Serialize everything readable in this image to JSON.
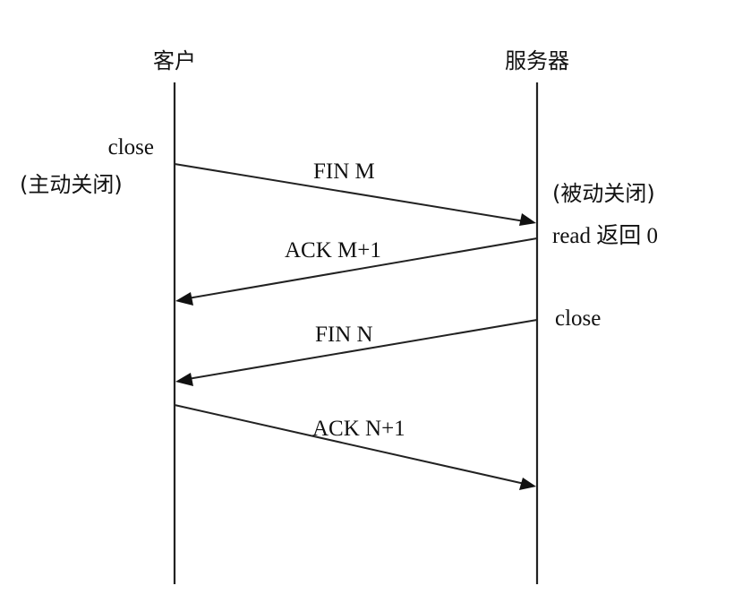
{
  "participants": {
    "client": "客户",
    "server": "服务器"
  },
  "client_notes": {
    "close": "close",
    "active_close": "(主动关闭)"
  },
  "server_notes": {
    "passive_close": "(被动关闭)",
    "read_returns": "read 返回 0",
    "close": "close"
  },
  "messages": [
    {
      "label": "FIN M",
      "direction": "client-to-server"
    },
    {
      "label": "ACK M+1",
      "direction": "server-to-client"
    },
    {
      "label": "FIN N",
      "direction": "server-to-client"
    },
    {
      "label": "ACK N+1",
      "direction": "client-to-server"
    }
  ]
}
